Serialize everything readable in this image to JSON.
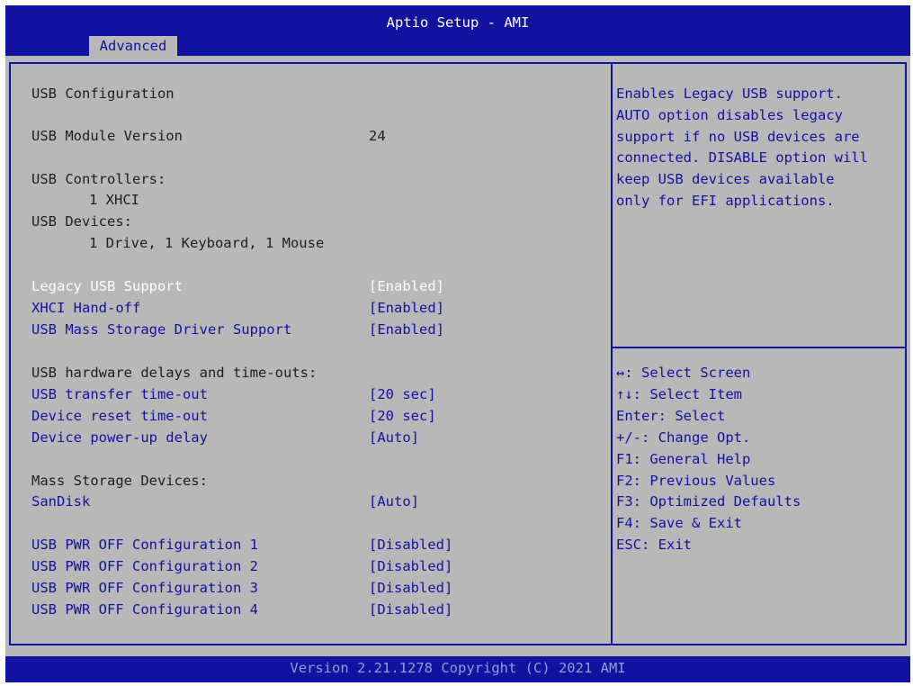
{
  "header": {
    "title": "Aptio Setup - AMI",
    "tab": "Advanced"
  },
  "info": {
    "heading": "USB Configuration",
    "module_label": "USB Module Version",
    "module_value": "24",
    "controllers_label": "USB Controllers:",
    "controllers_value": "1 XHCI",
    "devices_label": "USB Devices:",
    "devices_value": "1 Drive, 1 Keyboard, 1 Mouse"
  },
  "settings": [
    {
      "label": "Legacy USB Support",
      "value": "[Enabled]"
    },
    {
      "label": "XHCI Hand-off",
      "value": "[Enabled]"
    },
    {
      "label": "USB Mass Storage Driver Support",
      "value": "[Enabled]"
    }
  ],
  "timeouts": {
    "heading": "USB hardware delays and time-outs:",
    "items": [
      {
        "label": "USB transfer time-out",
        "value": "[20 sec]"
      },
      {
        "label": "Device reset time-out",
        "value": "[20 sec]"
      },
      {
        "label": "Device power-up delay",
        "value": "[Auto]"
      }
    ]
  },
  "mass_storage": {
    "heading": "Mass Storage Devices:",
    "items": [
      {
        "label": "SanDisk",
        "value": "[Auto]"
      }
    ]
  },
  "pwr_off": [
    {
      "label": "USB PWR OFF Configuration 1",
      "value": "[Disabled]"
    },
    {
      "label": "USB PWR OFF Configuration 2",
      "value": "[Disabled]"
    },
    {
      "label": "USB PWR OFF Configuration 3",
      "value": "[Disabled]"
    },
    {
      "label": "USB PWR OFF Configuration 4",
      "value": "[Disabled]"
    }
  ],
  "help": {
    "lines": [
      "Enables Legacy USB support.",
      "AUTO option disables legacy",
      "support if no USB devices are",
      "connected. DISABLE option will",
      "keep USB devices available",
      "only for EFI applications."
    ]
  },
  "keys": [
    "↔: Select Screen",
    "↑↓: Select Item",
    "Enter: Select",
    "+/-: Change Opt.",
    "F1: General Help",
    "F2: Previous Values",
    "F3: Optimized Defaults",
    "F4: Save & Exit",
    "ESC: Exit"
  ],
  "footer": {
    "version": "Version 2.21.1278 Copyright (C) 2021 AMI"
  },
  "colors": {
    "blue": "#1212a0",
    "panel": "#b8b8b8",
    "text": "#202020",
    "selected": "#ffffff"
  }
}
